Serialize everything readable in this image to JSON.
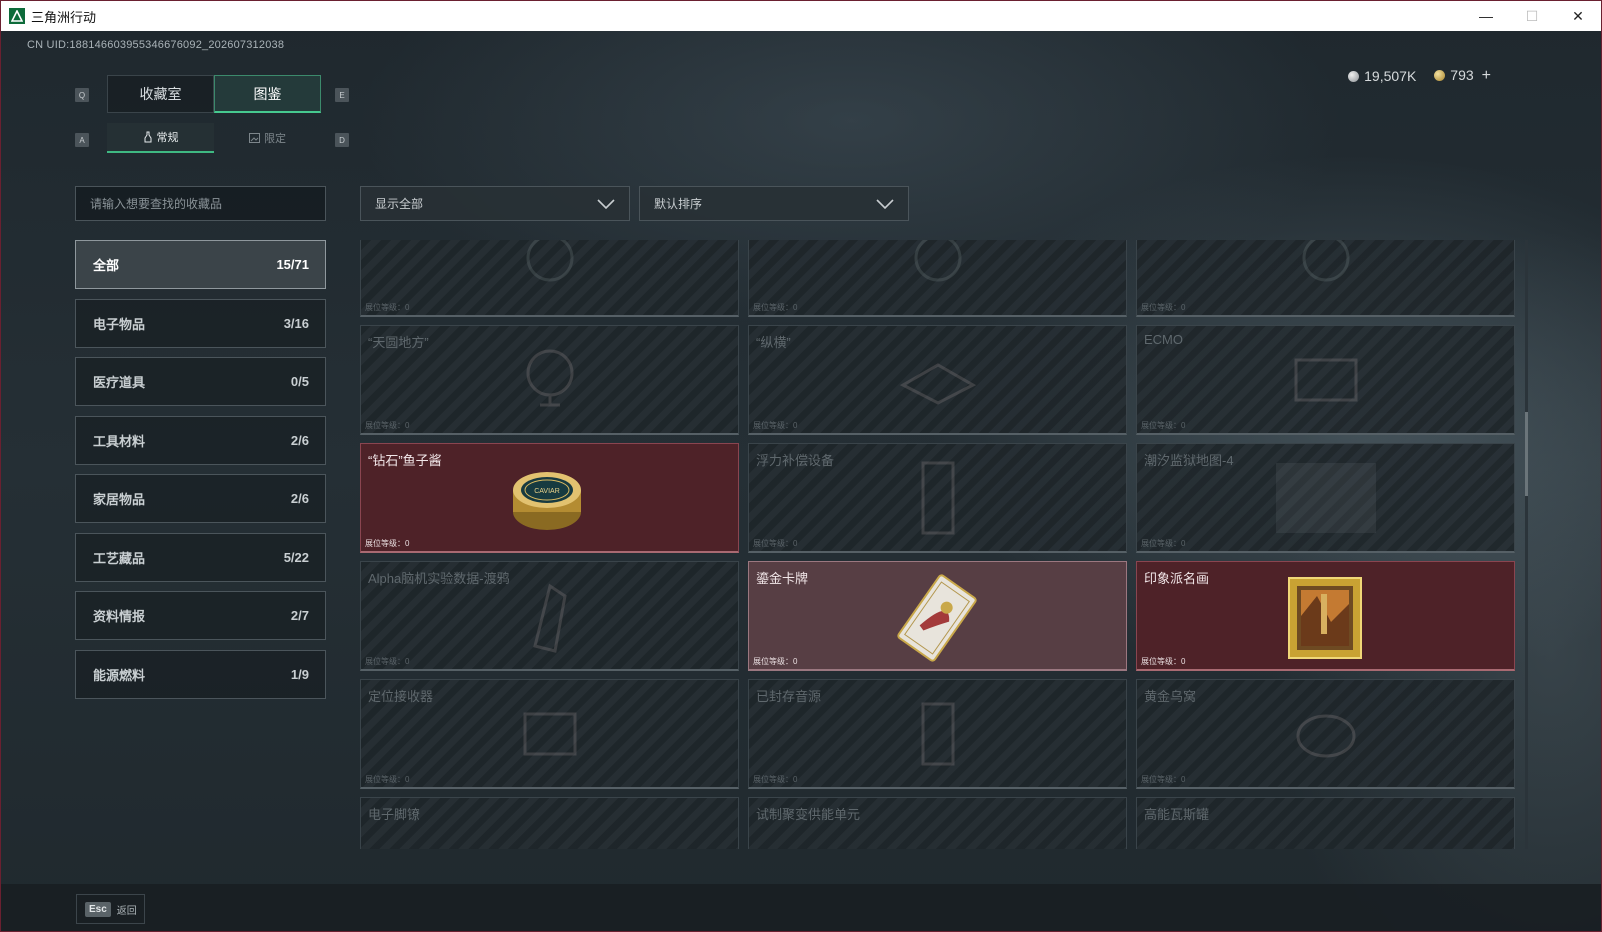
{
  "window": {
    "title": "三角洲行动",
    "minimize": "—",
    "maximize": "☐",
    "close": "✕"
  },
  "uid": "CN UID:18814660395534667609​2_202607312038",
  "currency": {
    "silver": "19,507K",
    "gold": "793",
    "plus": "+"
  },
  "keys": {
    "q": "Q",
    "e": "E",
    "a": "A",
    "d": "D"
  },
  "tabs": [
    {
      "label": "收藏室"
    },
    {
      "label": "图鉴"
    }
  ],
  "subtabs": [
    {
      "label": "常规"
    },
    {
      "label": "限定"
    }
  ],
  "search": {
    "placeholder": "请输入想要查找的收藏品"
  },
  "filter": {
    "label": "显示全部"
  },
  "sort": {
    "label": "默认排序"
  },
  "categories": [
    {
      "label": "全部",
      "count": "15/71"
    },
    {
      "label": "电子物品",
      "count": "3/16"
    },
    {
      "label": "医疗道具",
      "count": "0/5"
    },
    {
      "label": "工具材料",
      "count": "2/6"
    },
    {
      "label": "家居物品",
      "count": "2/6"
    },
    {
      "label": "工艺藏品",
      "count": "5/22"
    },
    {
      "label": "资料情报",
      "count": "2/7"
    },
    {
      "label": "能源燃料",
      "count": "1/9"
    }
  ],
  "level_label": "展位等级：0",
  "items": [
    {
      "name": "",
      "owned": false
    },
    {
      "name": "",
      "owned": false
    },
    {
      "name": "",
      "owned": false
    },
    {
      "name": "“天圆地方”",
      "owned": false
    },
    {
      "name": "“纵横”",
      "owned": false
    },
    {
      "name": "ECMO",
      "owned": false
    },
    {
      "name": "“钻石”鱼子酱",
      "owned": true
    },
    {
      "name": "浮力补偿设备",
      "owned": false
    },
    {
      "name": "潮汐监狱地图-4",
      "owned": false
    },
    {
      "name": "Alpha脑机实验数据-渡鸦",
      "owned": false
    },
    {
      "name": "鎏金卡牌",
      "owned": true
    },
    {
      "name": "印象派名画",
      "owned": true
    },
    {
      "name": "定位接收器",
      "owned": false
    },
    {
      "name": "已封存音源",
      "owned": false
    },
    {
      "name": "黄金乌窝",
      "owned": false
    },
    {
      "name": "电子脚镣",
      "owned": false
    },
    {
      "name": "试制聚变供能单元",
      "owned": false
    },
    {
      "name": "高能瓦斯罐",
      "owned": false
    }
  ],
  "item_labels": {
    "caviar": "CAVIAR"
  },
  "footer": {
    "esc_key": "Esc",
    "back_label": "返回"
  },
  "colors": {
    "accent": "#46c98f",
    "owned_card": "#4e2228",
    "titlebar": "#ffffff"
  }
}
